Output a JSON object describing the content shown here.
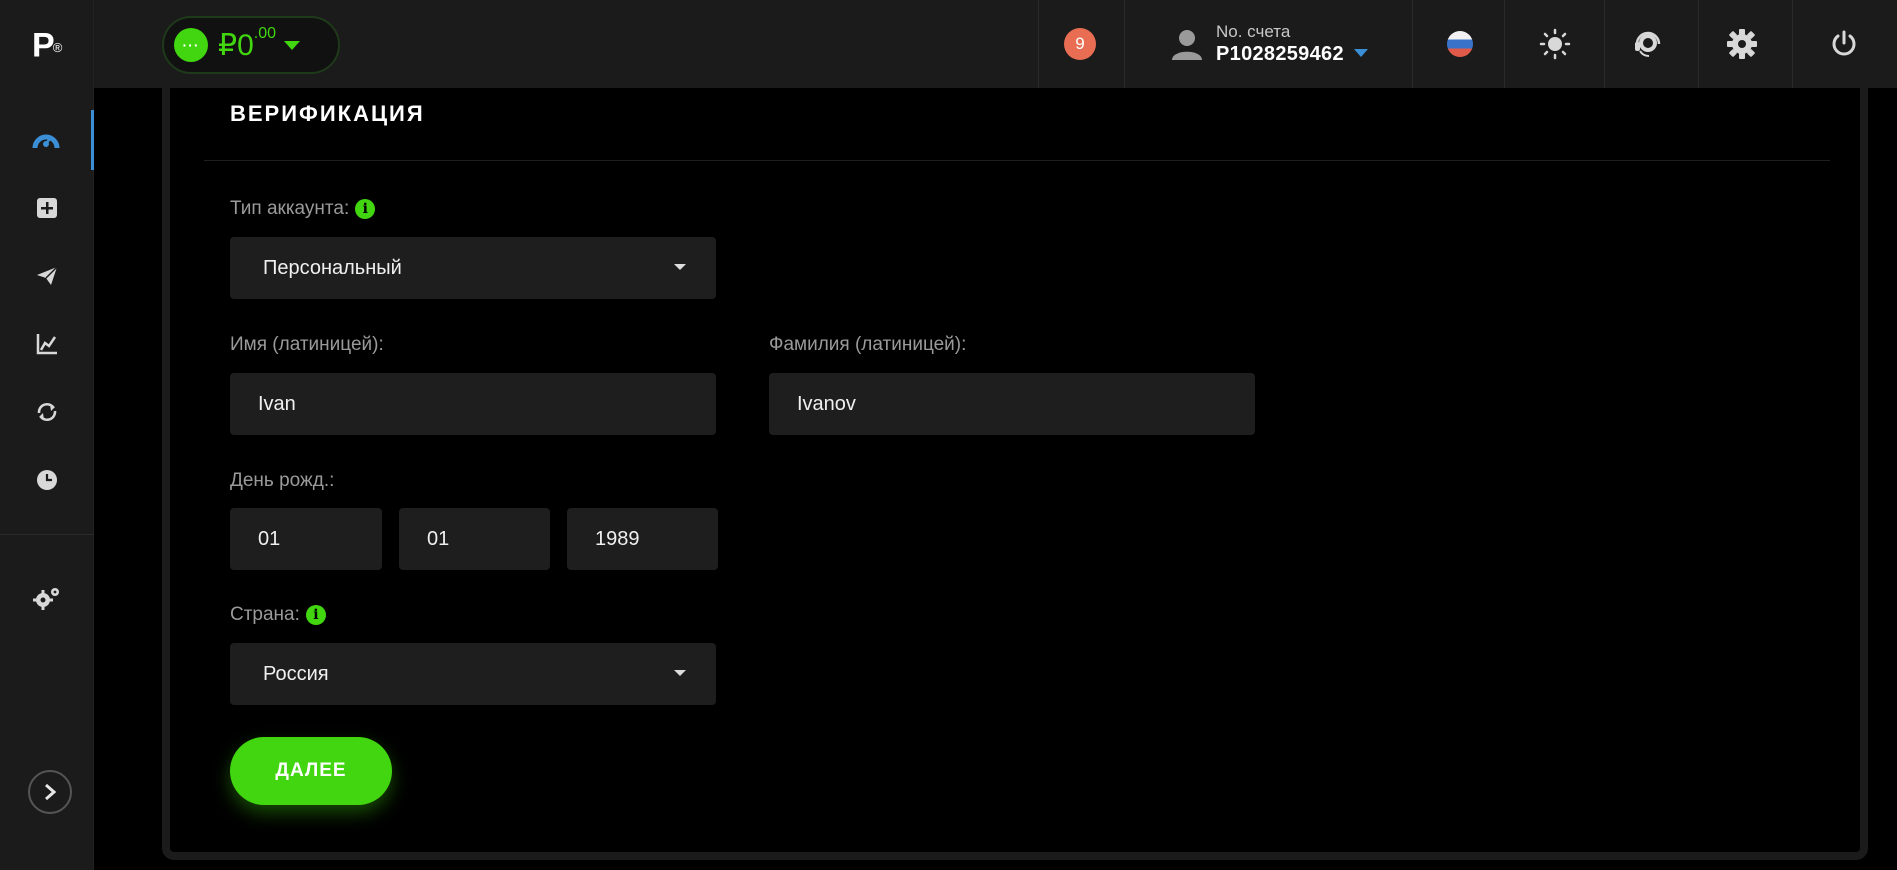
{
  "app": {
    "logo_text": "P",
    "logo_mark": "®"
  },
  "sidebar": {
    "items": [
      {
        "icon": "dashboard-icon",
        "active": true
      },
      {
        "icon": "add-square-icon"
      },
      {
        "icon": "send-icon"
      },
      {
        "icon": "chart-icon"
      },
      {
        "icon": "exchange-icon"
      },
      {
        "icon": "history-clock-icon"
      },
      {
        "icon": "settings-gears-icon"
      }
    ],
    "expand_icon": "chevron-right-icon"
  },
  "header": {
    "balance": {
      "currency": "₽",
      "integer": "0",
      "decimals": ".00",
      "dots": "···"
    },
    "notifications_count": "9",
    "account": {
      "label": "No. счета",
      "number": "P1028259462"
    },
    "icons": [
      "russia-flag-icon",
      "sun-theme-icon",
      "support-headset-icon",
      "gear-icon",
      "power-icon"
    ],
    "colors": {
      "accent_green": "#41d60f",
      "accent_blue": "#3b8fd6",
      "badge": "#e86d52"
    }
  },
  "form": {
    "title": "ВЕРИФИКАЦИЯ",
    "account_type": {
      "label": "Тип аккаунта:",
      "value": "Персональный"
    },
    "first_name": {
      "label": "Имя (латиницей):",
      "value": "Ivan"
    },
    "last_name": {
      "label": "Фамилия (латиницей):",
      "value": "Ivanov"
    },
    "birthdate": {
      "label": "День рожд.:",
      "day": "01",
      "month": "01",
      "year": "1989"
    },
    "country": {
      "label": "Страна:",
      "value": "Россия"
    },
    "info_glyph": "i",
    "submit_label": "ДАЛЕЕ"
  }
}
